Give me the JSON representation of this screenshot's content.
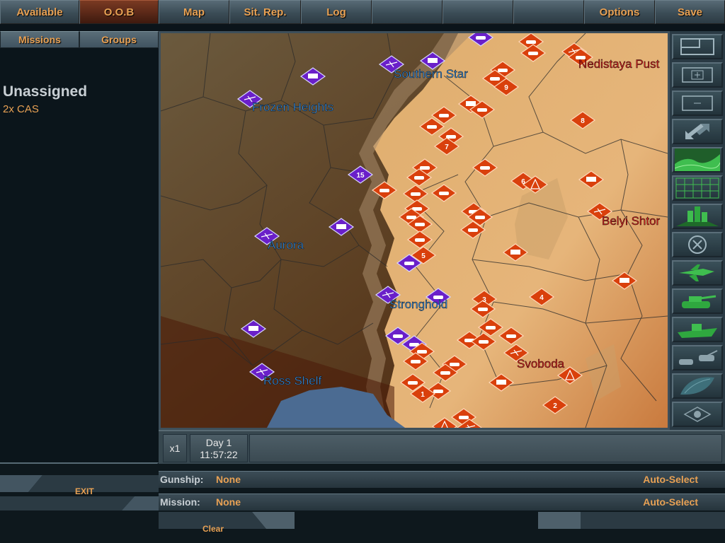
{
  "topbar": {
    "tabs": [
      "Available",
      "O.O.B",
      "Map",
      "Sit. Rep.",
      "Log",
      "",
      "",
      "",
      "Options",
      "Save"
    ]
  },
  "left": {
    "subtabs": [
      "Missions",
      "Groups"
    ],
    "title": "Unassigned",
    "item": "2x CAS"
  },
  "map": {
    "blue_labels": [
      "Southern Star",
      "Frozen Heights",
      "Aurora",
      "Stronghold",
      "Ross Shelf"
    ],
    "red_labels": [
      "Nedistaya Pust",
      "Belyi Shtor",
      "Svoboda"
    ],
    "unit_numbers": [
      "15",
      "9",
      "8",
      "7",
      "6",
      "5",
      "4",
      "3",
      "2",
      "1"
    ],
    "colors": {
      "blue_units": "#6a1fc9",
      "red_units": "#d9400c",
      "blue_text": "#3a8fe0",
      "red_text": "#d41e1e"
    }
  },
  "toolbar": {
    "tools": [
      "layout-icon",
      "zoom-in-icon",
      "zoom-out-icon",
      "swap-icon",
      "terrain-icon",
      "grid-icon",
      "city-icon",
      "cancel-icon",
      "aircraft-filter-icon",
      "armor-filter-icon",
      "naval-filter-icon",
      "ground-units-icon",
      "overlay-icon",
      "center-icon"
    ]
  },
  "time": {
    "speed": "x1",
    "day": "Day 1",
    "clock": "11:57:22"
  },
  "bottom": {
    "gunship_label": "Gunship:",
    "gunship_value": "None",
    "mission_label": "Mission:",
    "mission_value": "None",
    "auto_select": "Auto-Select",
    "exit": "EXIT",
    "clear": "Clear"
  }
}
